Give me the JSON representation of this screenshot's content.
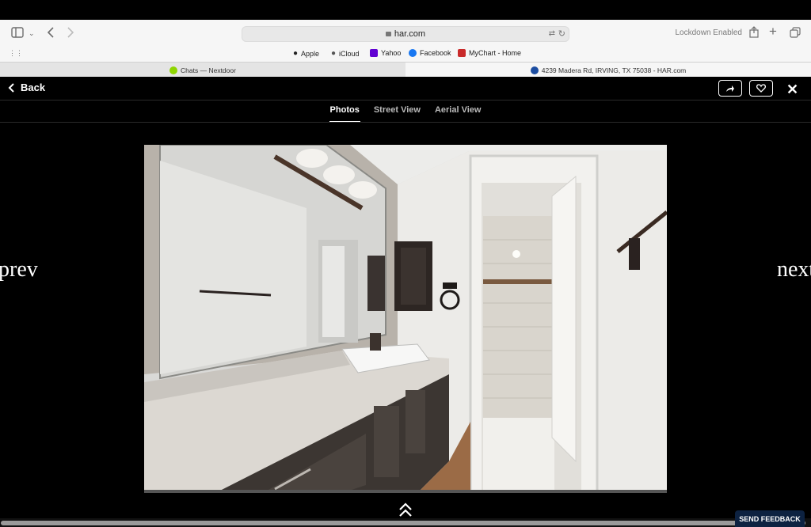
{
  "browser": {
    "url": "har.com",
    "lockdown": "Lockdown Enabled",
    "favorites": [
      "Apple",
      "iCloud",
      "Yahoo",
      "Facebook",
      "MyChart - Home"
    ],
    "tabs": [
      "Chats — Nextdoor",
      "4239 Madera Rd, IRVING, TX 75038 - HAR.com"
    ]
  },
  "viewer": {
    "back_label": "Back",
    "tabs": [
      "Photos",
      "Street View",
      "Aerial View"
    ],
    "prev_label": "prev",
    "next_label": "next",
    "feedback_label": "SEND FEEDBACK"
  },
  "colors": {
    "accent_dark": "#0d2241",
    "yahoo": "#6001d2",
    "facebook": "#1877f2",
    "mychart": "#c92a2a"
  }
}
